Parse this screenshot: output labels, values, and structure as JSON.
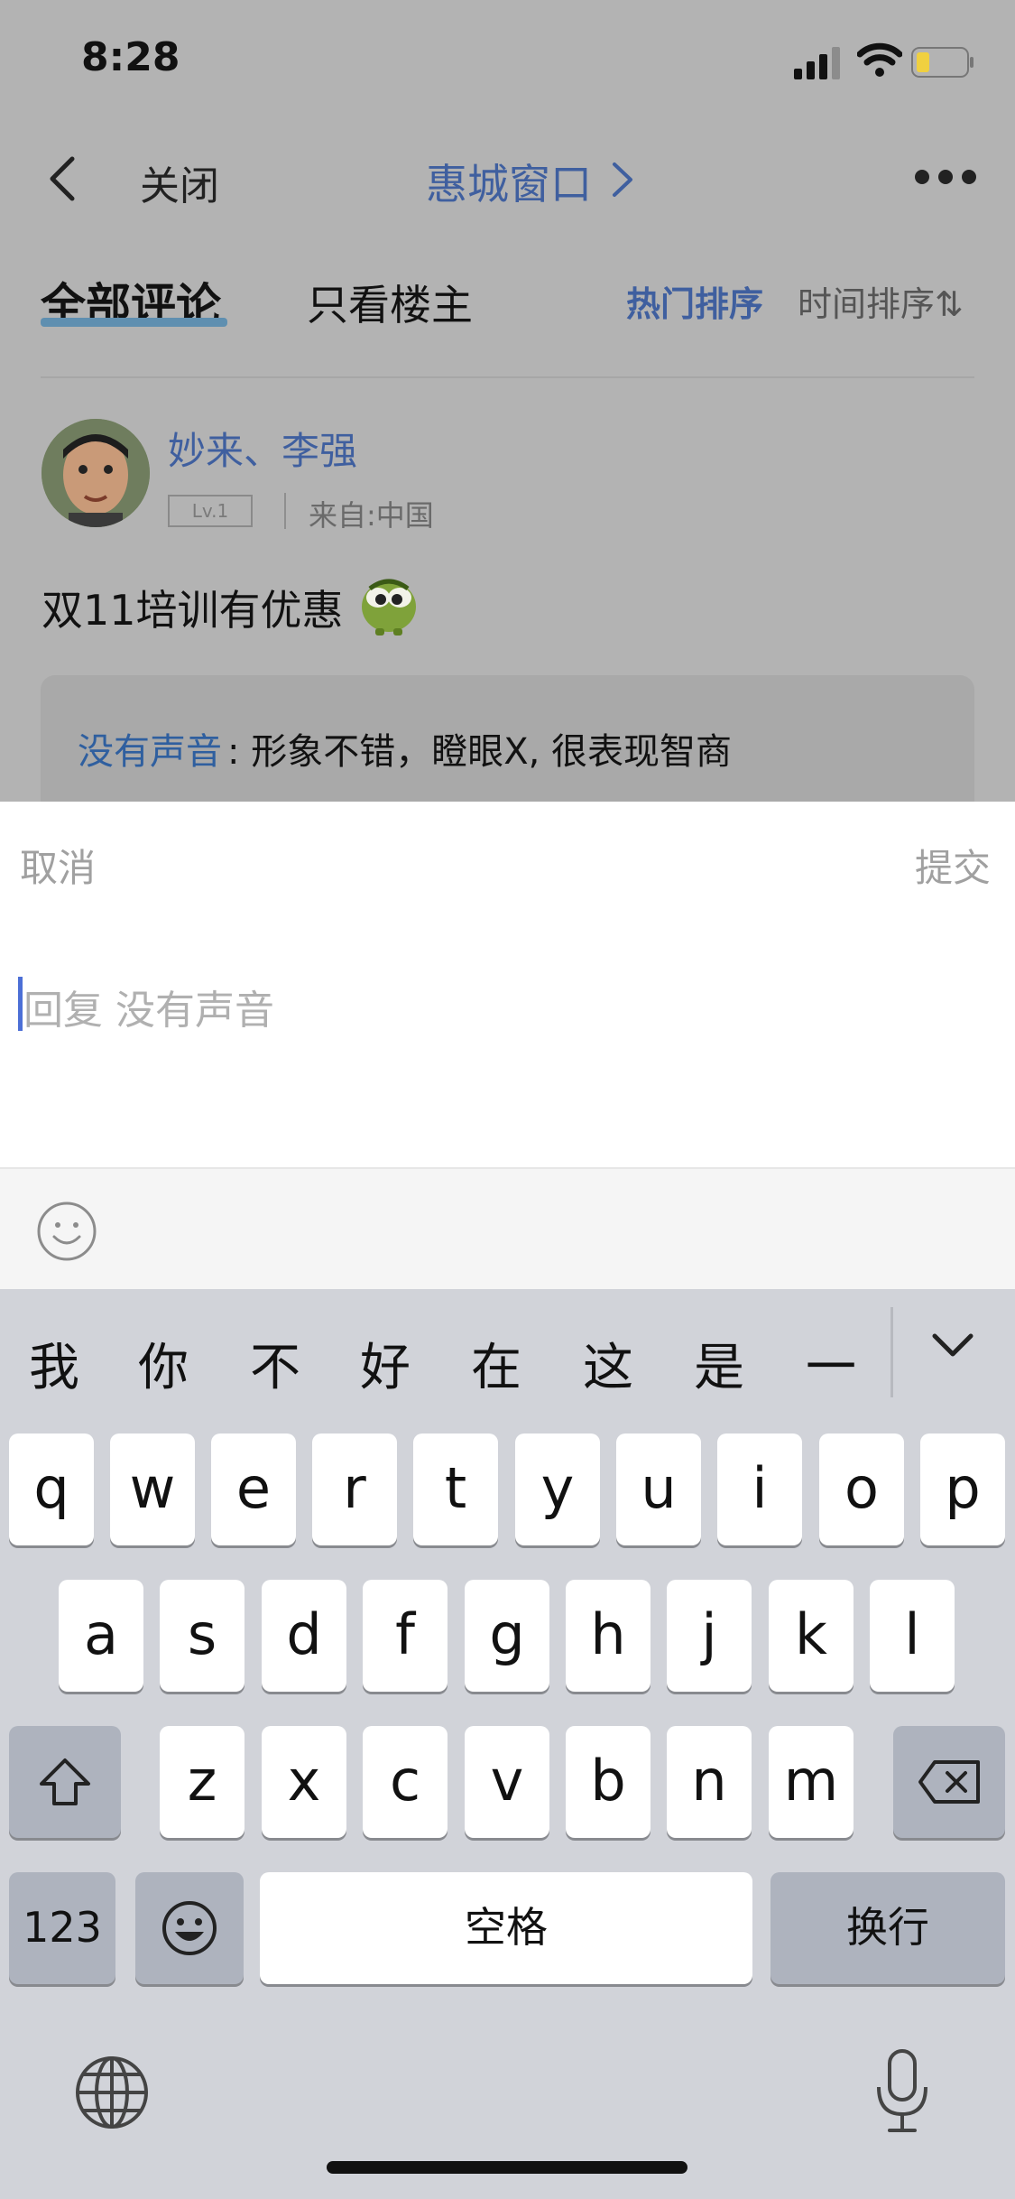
{
  "status_bar": {
    "time": "8:28"
  },
  "nav": {
    "close_label": "关闭",
    "title": "惠城窗口"
  },
  "tabs": {
    "all_comments": "全部评论",
    "owner_only": "只看楼主"
  },
  "sort": {
    "hot": "热门排序",
    "time": "时间排序⇅"
  },
  "post": {
    "username": "妙来、李强",
    "level": "Lv.1",
    "origin": "来自:中国",
    "text": "双11培训有优惠",
    "reply": {
      "name": "没有声音",
      "text": ": 形象不错，瞪眼X, 很表现智商"
    }
  },
  "composer": {
    "cancel_label": "取消",
    "submit_label": "提交",
    "placeholder": "回复 没有声音"
  },
  "keyboard": {
    "candidates": [
      "我",
      "你",
      "不",
      "好",
      "在",
      "这",
      "是",
      "一"
    ],
    "row1": [
      "q",
      "w",
      "e",
      "r",
      "t",
      "y",
      "u",
      "i",
      "o",
      "p"
    ],
    "row2": [
      "a",
      "s",
      "d",
      "f",
      "g",
      "h",
      "j",
      "k",
      "l"
    ],
    "row3": [
      "z",
      "x",
      "c",
      "v",
      "b",
      "n",
      "m"
    ],
    "numbers_label": "123",
    "space_label": "空格",
    "return_label": "换行"
  }
}
